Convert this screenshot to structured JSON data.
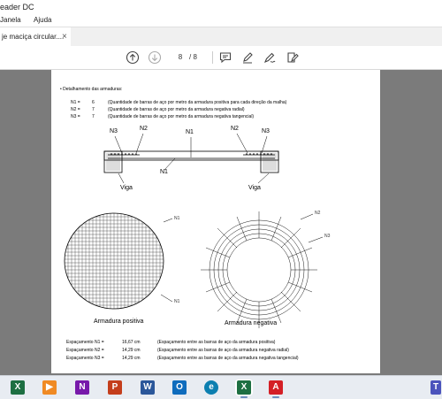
{
  "window": {
    "title": "eader DC"
  },
  "menu": {
    "items": [
      "Janela",
      "Ajuda"
    ]
  },
  "tab": {
    "title": "je maciça circular....",
    "close": "×"
  },
  "toolbar": {
    "page_current": "8",
    "page_sep": "/ 8"
  },
  "document": {
    "section_title": "• Detalhamento das armaduras:",
    "rebars": [
      {
        "name": "N1 =",
        "value": "6",
        "desc": "(Quantidade de barras de aço por metro da armadura positiva para cada direção da malha)"
      },
      {
        "name": "N2 =",
        "value": "7",
        "desc": "(Quantidade de barras de aço por metro da armadura negativa radial)"
      },
      {
        "name": "N3 =",
        "value": "7",
        "desc": "(Quantidade de barras de aço por metro da armadura negativa tangencial)"
      }
    ],
    "section": {
      "n3_left": "N3",
      "n2_left": "N2",
      "n1_top": "N1",
      "n2_right": "N2",
      "n3_right": "N3",
      "n1_bottom": "N1",
      "viga_left": "Viga",
      "viga_right": "Viga"
    },
    "positive": {
      "label": "Armadura positiva",
      "n1_top": "N1",
      "n1_bottom": "N1"
    },
    "negative": {
      "label": "Armadura negativa",
      "n2": "N2",
      "n3": "N3"
    },
    "spacing": [
      {
        "name": "Espaçamento N1 =",
        "value": "16,67  cm",
        "desc": "(Espaçamento entre as barras de aço da armadura positiva)"
      },
      {
        "name": "Espaçamento N2 =",
        "value": "14,29  cm",
        "desc": "(Espaçamento entre as barras de aço da armadura negativa radial)"
      },
      {
        "name": "Espaçamento N3 =",
        "value": "14,29  cm",
        "desc": "(Espaçamento entre as barras de aço da armadura negativa tangencial)"
      }
    ]
  },
  "taskbar": {
    "apps": [
      {
        "name": "excel",
        "glyph": "X",
        "color": "#1d6f42"
      },
      {
        "name": "media-player",
        "glyph": "▶",
        "color": "#f08a24"
      },
      {
        "name": "onenote",
        "glyph": "N",
        "color": "#7719aa"
      },
      {
        "name": "powerpoint",
        "glyph": "P",
        "color": "#c43e1c"
      },
      {
        "name": "word",
        "glyph": "W",
        "color": "#2b579a"
      },
      {
        "name": "outlook",
        "glyph": "O",
        "color": "#0f6cbd"
      },
      {
        "name": "edge",
        "glyph": "e",
        "color": "#0c7fb0"
      },
      {
        "name": "excel-open",
        "glyph": "X",
        "color": "#1d6f42"
      },
      {
        "name": "acrobat-reader",
        "glyph": "A",
        "color": "#d41f26"
      },
      {
        "name": "teams",
        "glyph": "T",
        "color": "#4b53bc"
      }
    ]
  }
}
